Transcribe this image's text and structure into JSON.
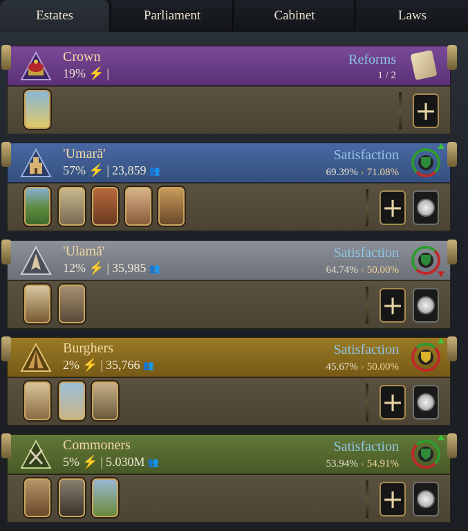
{
  "tabs": [
    {
      "label": "Estates",
      "active": true
    },
    {
      "label": "Parliament",
      "active": false
    },
    {
      "label": "Cabinet",
      "active": false
    },
    {
      "label": "Laws",
      "active": false
    }
  ],
  "crown": {
    "name": "Crown",
    "power": "19%",
    "separator": "|",
    "reforms_label": "Reforms",
    "reforms_count": "1 / 2",
    "color": "#6a3e86"
  },
  "estates": [
    {
      "name": "'Umarā'",
      "power": "57%",
      "population": "23,859",
      "satisfaction_label": "Satisfaction",
      "satisfaction_now": "69.39%",
      "satisfaction_target": "71.08%",
      "trend": "up",
      "color": "#3e5a92",
      "privileges": [
        "farmland-privilege-icon",
        "noble-lady-privilege-icon",
        "market-privilege-icon",
        "tax-privilege-icon",
        "cavalry-privilege-icon"
      ]
    },
    {
      "name": "'Ulamā'",
      "power": "12%",
      "population": "35,985",
      "satisfaction_label": "Satisfaction",
      "satisfaction_now": "64.74%",
      "satisfaction_target": "50.00%",
      "trend": "down",
      "color": "#7c8088",
      "privileges": [
        "scripture-privilege-icon",
        "scholars-privilege-icon"
      ]
    },
    {
      "name": "Burghers",
      "power": "2%",
      "population": "35,766",
      "satisfaction_label": "Satisfaction",
      "satisfaction_now": "45.67%",
      "satisfaction_target": "50.00%",
      "trend": "up",
      "color": "#8a6a1e",
      "privileges": [
        "town-privilege-icon",
        "ship-privilege-icon",
        "merchant-privilege-icon"
      ]
    },
    {
      "name": "Commoners",
      "power": "5%",
      "population": "5.030M",
      "satisfaction_label": "Satisfaction",
      "satisfaction_now": "53.94%",
      "satisfaction_target": "54.91%",
      "trend": "up",
      "color": "#566a30",
      "privileges": [
        "goods-privilege-icon",
        "levy-privilege-icon",
        "livestock-privilege-icon"
      ]
    }
  ],
  "icons": {
    "bolt": "⚡",
    "arrow": "›",
    "plus": "+"
  }
}
